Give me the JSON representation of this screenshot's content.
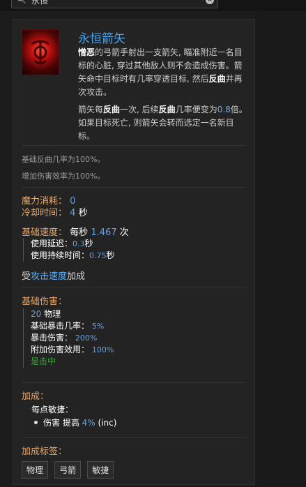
{
  "search": {
    "value": "永恒"
  },
  "skill": {
    "title": "永恒箭矢",
    "desc_p1_b1": "憎恶",
    "desc_p1_t1": "的弓箭手射出一支箭矢, 瞄准附近一名目标的心脏, 穿过其他敌人则不会造成伤害。箭矢命中目标时有几率穿透目标, 然后",
    "desc_p1_b2": "反曲",
    "desc_p1_t2": "并再次攻击。",
    "desc_p2_t1": "箭矢每",
    "desc_p2_b1": "反曲",
    "desc_p2_t2": "一次, 后续",
    "desc_p2_b2": "反曲",
    "desc_p2_t3": "几率便变为",
    "desc_p2_num": "0.8",
    "desc_p2_t4": "倍。如果目标死亡, 则箭矢会转而选定一名新目标。"
  },
  "base": {
    "line1": "基础反曲几率为100%。",
    "line2": "增加伤害效率为100%。"
  },
  "mana": {
    "label": "魔力消耗：",
    "value": "0"
  },
  "cooldown": {
    "label": "冷却时间：",
    "value": "4",
    "unit": "秒"
  },
  "speed": {
    "label": "基础速度：",
    "prefix": "每秒",
    "value": "1.467",
    "unit": "次",
    "delay_label": "使用延迟：",
    "delay_value": "0.3",
    "delay_unit": "秒",
    "duration_label": "使用持续时间：",
    "duration_value": "0.75",
    "duration_unit": "秒",
    "note_pre": "受",
    "note_link": "攻击速度",
    "note_post": "加成"
  },
  "damage": {
    "label": "基础伤害：",
    "phys_value": "20",
    "phys_label": "物理",
    "crit_label": "基础暴击几率：",
    "crit_value": "5%",
    "critdmg_label": "暴击伤害：",
    "critdmg_value": "200%",
    "eff_label": "附加伤害效用：",
    "eff_value": "100%",
    "onhit": "是击中"
  },
  "scaling": {
    "label": "加成：",
    "per_label": "每点敏捷：",
    "item_pre": "伤害 提高",
    "item_value": "4%",
    "item_post": "(inc)"
  },
  "tags": {
    "label": "加成标签：",
    "items": [
      "物理",
      "弓箭",
      "敏捷"
    ]
  }
}
